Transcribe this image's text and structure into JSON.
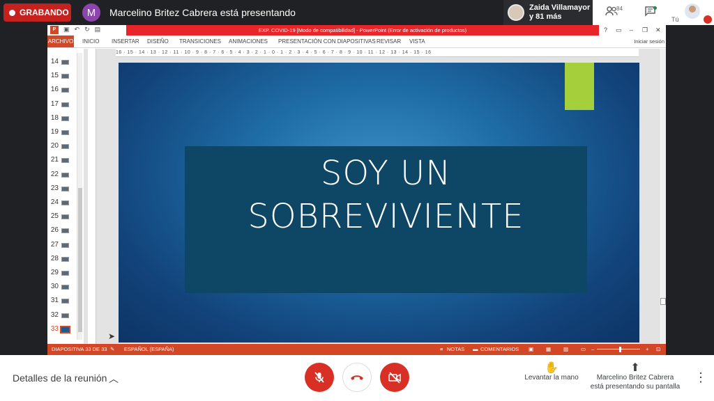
{
  "meet": {
    "recording_label": "GRABANDO",
    "presenter_initial": "M",
    "presenter_text": "Marcelino Britez Cabrera está presentando",
    "participants_line1": "Zaida Villamayor",
    "participants_line2": "y 81 más",
    "participants_count": "84",
    "self_label": "Tú",
    "meeting_details": "Detalles de la reunión",
    "raise_hand": "Levantar la mano",
    "presenting_line1": "Marcelino Britez Cabrera",
    "presenting_line2": "está presentando su pantalla",
    "colors": {
      "record": "#c5221f",
      "end_call": "#d93025",
      "presenter_avatar": "#8e44ad"
    }
  },
  "ppt": {
    "window_title": "EXP. COVID-19 [Modo de compatibilidad] - PowerPoint (Error de activación de productos)",
    "tabs": [
      "ARCHIVO",
      "INICIO",
      "INSERTAR",
      "DISEÑO",
      "TRANSICIONES",
      "ANIMACIONES",
      "PRESENTACIÓN CON DIAPOSITIVAS",
      "REVISAR",
      "VISTA"
    ],
    "sign_in": "Iniciar sesión",
    "ruler_text": "16 · 15 · 14 · 13 · 12 · 11 · 10 · 9 · 8 · 7 · 6 · 5 · 4 · 3 · 2 · 1 · 0 · 1 · 2 · 3 · 4 · 5 · 6 · 7 · 8 · 9 · 10 · 11 · 12 · 13 · 14 · 15 · 16",
    "slide_numbers": [
      "14",
      "15",
      "16",
      "17",
      "18",
      "19",
      "20",
      "21",
      "22",
      "23",
      "24",
      "25",
      "26",
      "27",
      "28",
      "29",
      "30",
      "31",
      "32",
      "33"
    ],
    "selected_slide": "33",
    "slide_title_line1": "SOY UN",
    "slide_title_line2": "SOBREVIVIENTE",
    "status_slide": "DIAPOSITIVA 33 DE 33",
    "status_language": "ESPAÑOL (ESPAÑA)",
    "status_notes": "NOTAS",
    "status_comments": "COMENTARIOS",
    "colors": {
      "accent": "#d24726",
      "slide_bg": "#1f6ea8",
      "slide_box": "#0e4666",
      "slide_bar": "#a5cf3b",
      "title_bar": "#e8262a"
    }
  }
}
